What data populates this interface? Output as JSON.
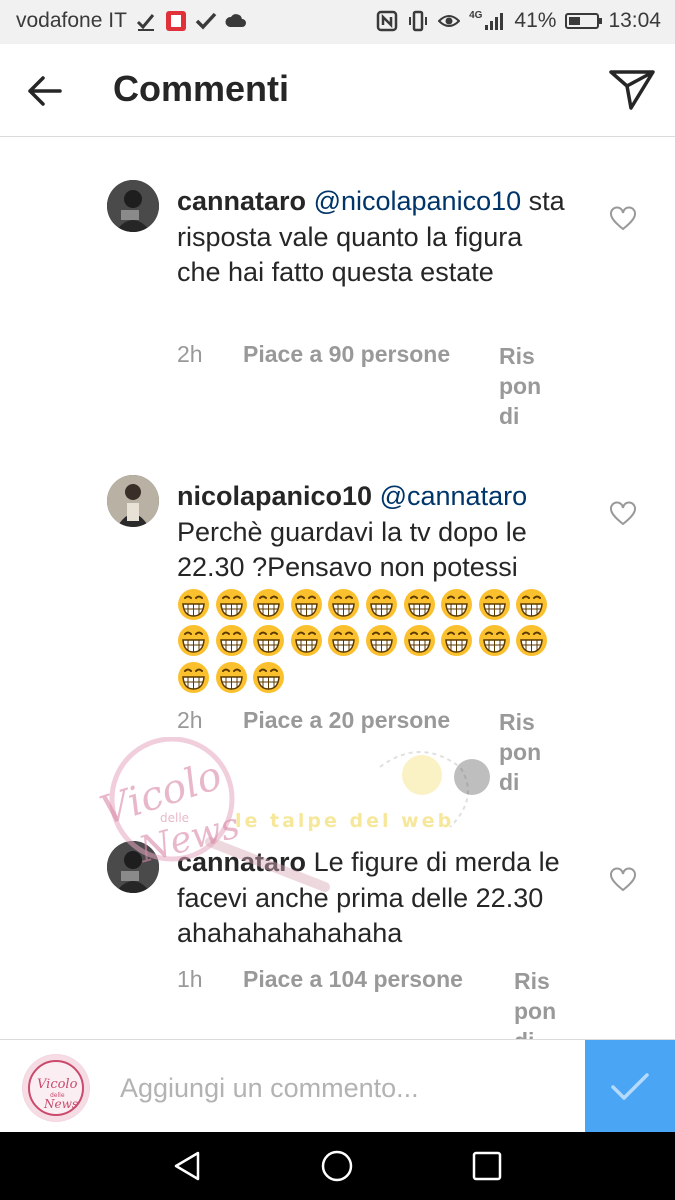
{
  "status_bar": {
    "carrier": "vodafone IT",
    "network": "4G",
    "battery_percent": "41%",
    "battery_level": 0.41,
    "time": "13:04"
  },
  "header": {
    "title": "Commenti",
    "back_icon": "arrow-left-icon",
    "send_icon": "paper-plane-icon"
  },
  "comments": [
    {
      "username": "cannataro",
      "mention": "@nicolapanico10",
      "text": "sta risposta vale quanto la figura che hai fatto questa estate",
      "time": "2h",
      "likes": "Piace a 90 persone",
      "reply": "Rispondi"
    },
    {
      "username": "nicolapanico10",
      "mention": "@cannataro",
      "text": "Perchè guardavi la tv dopo le 22.30 ?Pensavo non potessi",
      "emoji_count": 23,
      "emoji_icon": "grinning-face-emoji",
      "time": "2h",
      "likes": "Piace a 20 persone",
      "reply": "Rispondi"
    },
    {
      "username": "cannataro",
      "mention": "",
      "text": "Le figure di merda le facevi anche prima delle 22.30 ahahahahahahaha",
      "time": "1h",
      "likes": "Piace a 104 persone",
      "reply": "Rispondi"
    }
  ],
  "watermark": {
    "text1": "Vicolo",
    "text2": "delle",
    "text3": "News",
    "text4": "le talpe del web"
  },
  "composer": {
    "placeholder": "Aggiungi un commento...",
    "post_icon": "check-icon"
  },
  "colors": {
    "accent": "#4aa6f5",
    "mention": "#003569",
    "meta": "#999999"
  }
}
